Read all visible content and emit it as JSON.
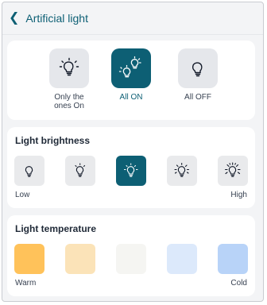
{
  "header": {
    "back_icon": "chevron-left-icon",
    "title": "Artificial light"
  },
  "modes": [
    {
      "label": "Only the\nones On",
      "icon": "bulb-glow-icon",
      "active": false
    },
    {
      "label": "All ON",
      "icon": "multi-bulb-glow-icon",
      "active": true
    },
    {
      "label": "All OFF",
      "icon": "bulb-off-icon",
      "active": false
    }
  ],
  "brightness": {
    "title": "Light brightness",
    "levels": 5,
    "selected_index": 2,
    "min_label": "Low",
    "max_label": "High"
  },
  "temperature": {
    "title": "Light temperature",
    "min_label": "Warm",
    "max_label": "Cold",
    "swatches": [
      "#ffc25a",
      "#fbe3b8",
      "#f5f5f2",
      "#dce9fb",
      "#b8d3f8"
    ]
  },
  "colors": {
    "accent": "#0d5f74",
    "tile": "#e5e7eb",
    "background": "#f3f4f6"
  }
}
